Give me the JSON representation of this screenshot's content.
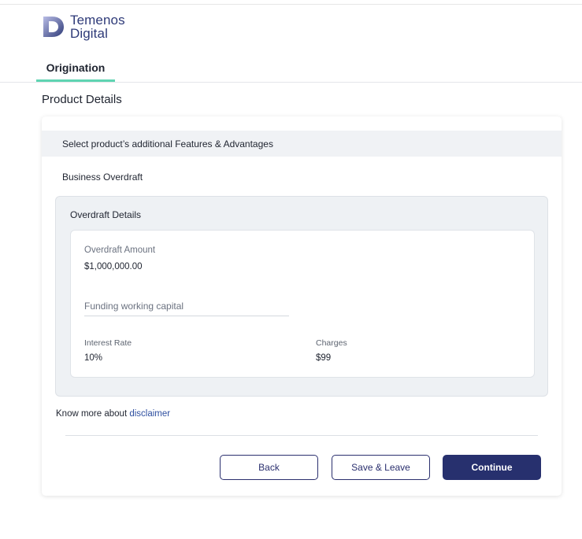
{
  "brand": {
    "name_line1": "Temenos",
    "name_line2": "Digital",
    "color": "#2e3a78"
  },
  "tabs": [
    {
      "label": "Origination",
      "active": true
    }
  ],
  "page": {
    "title": "Product Details"
  },
  "card": {
    "section_header": "Select product’s additional Features & Advantages",
    "product_name": "Business Overdraft",
    "overdraft": {
      "title": "Overdraft Details",
      "amount_label": "Overdraft Amount",
      "amount_value": "$1,000,000.00",
      "purpose_placeholder": "Funding working capital",
      "interest_rate_label": "Interest Rate",
      "interest_rate_value": "10%",
      "charges_label": "Charges",
      "charges_value": "$99"
    },
    "disclaimer": {
      "prefix": "Know more about",
      "link_text": "disclaimer"
    }
  },
  "actions": {
    "back_label": "Back",
    "save_leave_label": "Save & Leave",
    "continue_label": "Continue"
  },
  "colors": {
    "primary": "#27306e",
    "tab_accent": "#5fd4b2",
    "link": "#2e4fa0",
    "panel_background": "#eef1f4"
  }
}
